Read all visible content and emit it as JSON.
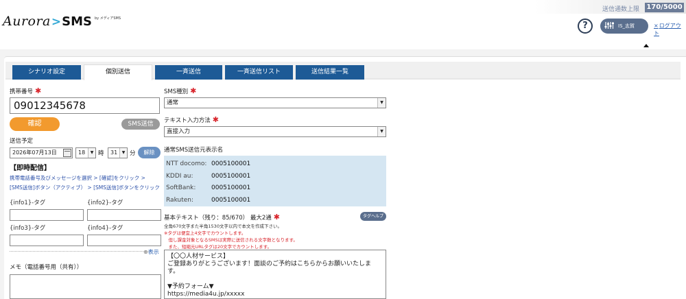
{
  "header": {
    "quota_label": "送信通数上限",
    "quota_value": "170/5000",
    "logo_main": "Aurora",
    "logo_chevron": ">",
    "logo_sms": "SMS",
    "logo_by": "by メディアSMS",
    "help_glyph": "?",
    "user_name": "IS_志賀",
    "logout_label": "ログアウト",
    "logout_glyph": "×"
  },
  "tabs": [
    {
      "label": "シナリオ設定",
      "active": false
    },
    {
      "label": "個別送信",
      "active": true
    },
    {
      "label": "一斉送信",
      "active": false
    },
    {
      "label": "一斉送信リスト",
      "active": false
    },
    {
      "label": "送信結果一覧",
      "active": false
    }
  ],
  "left": {
    "phone_label": "携帯番号",
    "required_mark": "✱",
    "phone_value": "09012345678",
    "confirm_label": "確認",
    "send_label": "SMS送信",
    "schedule_label": "送信予定",
    "date_value": "2026年07月13日",
    "hour_value": "18",
    "hour_unit": "時",
    "minute_value": "31",
    "minute_unit": "分",
    "clear_label": "解除",
    "instant_title": "【即時配信】",
    "instr_line1": "携帯電話番号及びメッセージを選択 > [確認]をクリック >",
    "instr_line2": "[SMS送信]ボタン（アクティブ） > [SMS送信]ボタンをクリック",
    "tags": [
      "{info1}-タグ",
      "{info2}-タグ",
      "{info3}-タグ",
      "{info4}-タグ"
    ],
    "show_glyph": "⊕",
    "show_label": "表示",
    "memo_label": "メモ（電話番号用（共有））"
  },
  "right": {
    "sms_type_label": "SMS種別",
    "sms_type_value": "通常",
    "text_method_label": "テキスト入力方法",
    "text_method_value": "直接入力",
    "sender_label": "通常SMS送信元表示名",
    "senders": [
      {
        "carrier": "NTT docomo:",
        "value": "0005100001"
      },
      {
        "carrier": "KDDI au:",
        "value": "0005100001"
      },
      {
        "carrier": "SoftBank:",
        "value": "0005100001"
      },
      {
        "carrier": "Rakuten:",
        "value": "0005100001"
      }
    ],
    "body_label": "基本テキスト（残り：85/670） 最大2通",
    "tag_help_label": "タグヘルプ",
    "note_black": "全角670文字また半角1530文字以内で本文を作成下さい。",
    "note_red1": "※タグは便宜上4文字でカウントします。",
    "note_red2": "　但し課金対象となるSMSは実際に送信される文字数となります。",
    "note_red3": "　また、短縮元URLタグは20文字でカウントします。",
    "body_text": "【〇〇人材サービス】\nご登録ありがとうございます！面談のご予約はこちらからお願いいたします。\n\n▼予約フォーム▼\nhttps://media4u.jp/xxxxx"
  },
  "colors": {
    "tab_blue": "#1d5a96",
    "confirm_orange": "#f29a2e",
    "required_red": "#d8232a",
    "sender_bg": "#d5e6f2",
    "logo_accent": "#33a9d6"
  },
  "icons": [
    "help-icon",
    "user-settings-icon",
    "close-icon",
    "calendar-icon",
    "caret-up-icon",
    "expand-icon"
  ]
}
